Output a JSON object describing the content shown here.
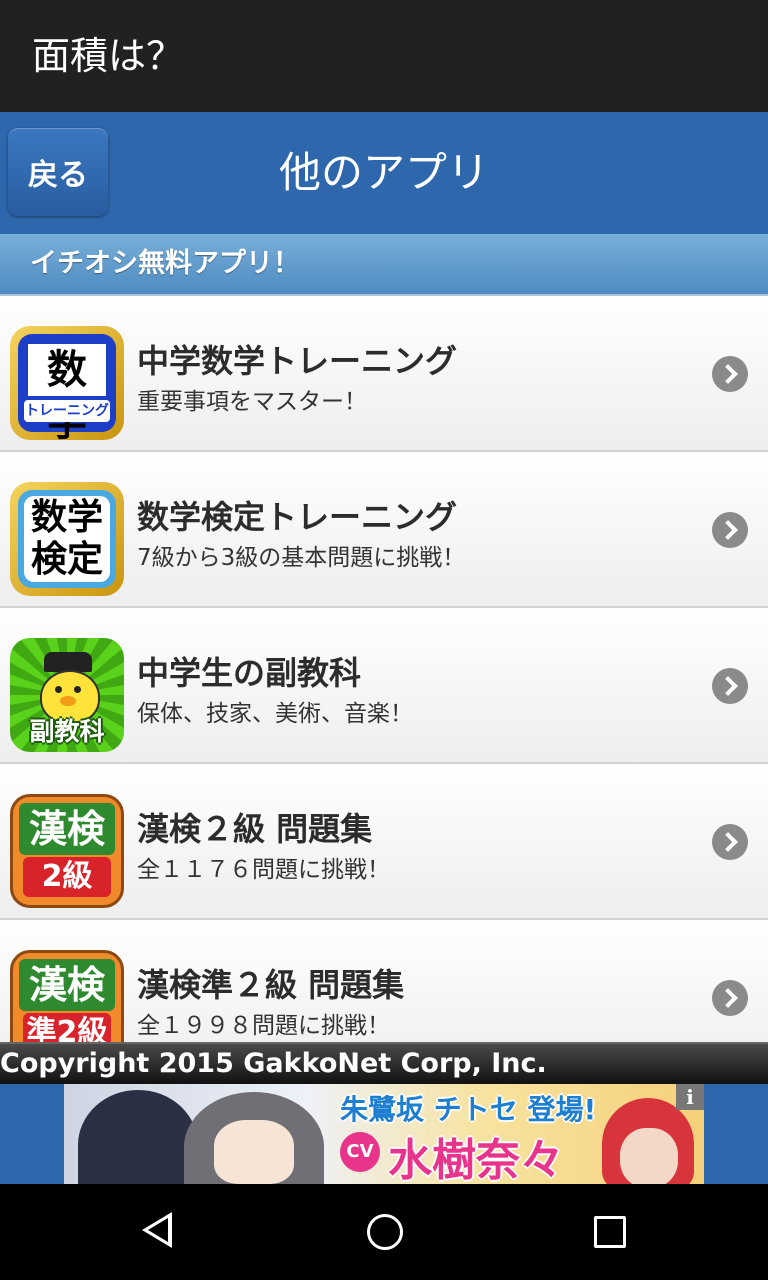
{
  "window": {
    "title": "面積は？"
  },
  "header": {
    "back_label": "戻る",
    "title": "他のアプリ"
  },
  "section": {
    "title": "イチオシ無料アプリ！"
  },
  "apps": [
    {
      "name": "中学数学トレーニング",
      "description": "重要事項をマスター！",
      "icon_text": "数学",
      "icon_sub": "トレーニング"
    },
    {
      "name": "数学検定トレーニング",
      "description": "7級から3級の基本問題に挑戦！",
      "icon_text": "数学検定"
    },
    {
      "name": "中学生の副教科",
      "description": "保体、技家、美術、音楽！",
      "icon_text": "副教科"
    },
    {
      "name": "漢検２級 問題集",
      "description": "全１１７６問題に挑戦！",
      "icon_top": "漢検",
      "icon_bottom": "2級"
    },
    {
      "name": "漢検準２級 問題集",
      "description": "全１９９８問題に挑戦！",
      "icon_top": "漢検",
      "icon_bottom": "準2級"
    }
  ],
  "footer": {
    "copyright": "Copyright 2015 GakkoNet Corp, Inc."
  },
  "ad": {
    "line1": "朱鷺坂 チトセ 登場!",
    "cv_badge": "CV",
    "line2": "水樹奈々",
    "info": "i"
  },
  "colors": {
    "title_bar": "#212121",
    "header": "#2f67ad",
    "section": "#5f9ccc",
    "nav_bar": "#000000"
  }
}
